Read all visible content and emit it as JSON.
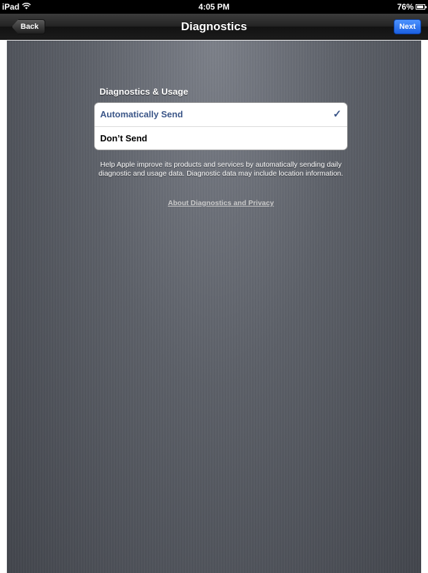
{
  "status_bar": {
    "device": "iPad",
    "time": "4:05 PM",
    "battery": "76%",
    "battery_level": 0.76
  },
  "nav": {
    "title": "Diagnostics",
    "back_label": "Back",
    "next_label": "Next"
  },
  "section": {
    "header": "Diagnostics & Usage",
    "options": [
      {
        "label": "Automatically Send",
        "selected": true
      },
      {
        "label": "Don’t Send",
        "selected": false
      }
    ],
    "checkmark": "✓",
    "footer": "Help Apple improve its products and services by automatically sending daily diagnostic and usage data. Diagnostic data may include location information.",
    "link": "About Diagnostics and Privacy"
  },
  "colors": {
    "selected_text": "#3b5688",
    "next_button": "#1b5fe0"
  }
}
